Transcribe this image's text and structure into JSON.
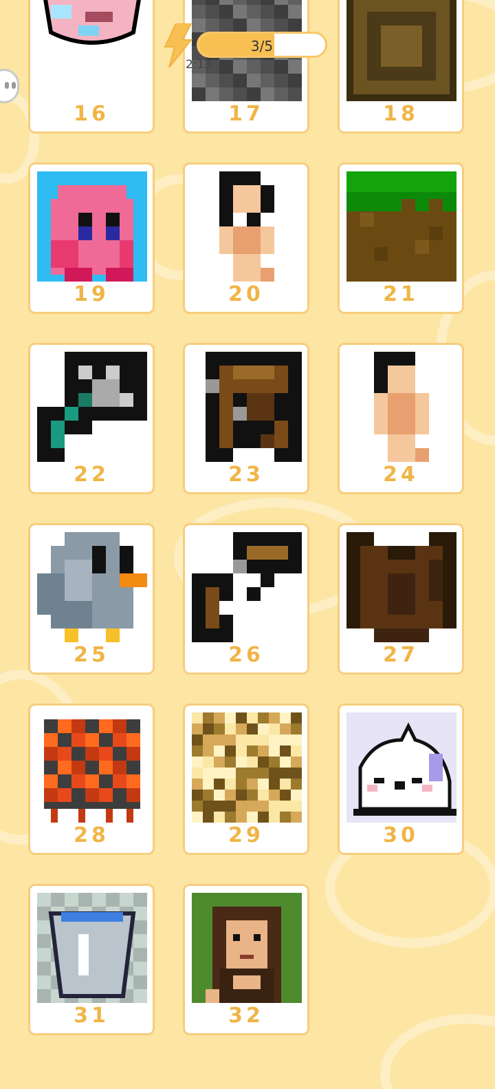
{
  "energy": {
    "label": "3/5",
    "current": 3,
    "max": 5,
    "timer": "2:13"
  },
  "levels": [
    {
      "number": "16",
      "art": "wing"
    },
    {
      "number": "17",
      "art": "stone"
    },
    {
      "number": "18",
      "art": "plank"
    },
    {
      "number": "19",
      "art": "kirby"
    },
    {
      "number": "20",
      "art": "figure"
    },
    {
      "number": "21",
      "art": "grass"
    },
    {
      "number": "22",
      "art": "diamond-axe"
    },
    {
      "number": "23",
      "art": "crossbow"
    },
    {
      "number": "24",
      "art": "figure-small"
    },
    {
      "number": "25",
      "art": "pigeon"
    },
    {
      "number": "26",
      "art": "bow"
    },
    {
      "number": "27",
      "art": "chestplate"
    },
    {
      "number": "28",
      "art": "magma"
    },
    {
      "number": "29",
      "art": "checker"
    },
    {
      "number": "30",
      "art": "seal"
    },
    {
      "number": "31",
      "art": "bucket"
    },
    {
      "number": "32",
      "art": "mona-lisa"
    }
  ],
  "colors": {
    "background": "#fde5a4",
    "card_border": "#f7cd7c",
    "number": "#f0b547",
    "energy_fill": "#f8c053"
  }
}
